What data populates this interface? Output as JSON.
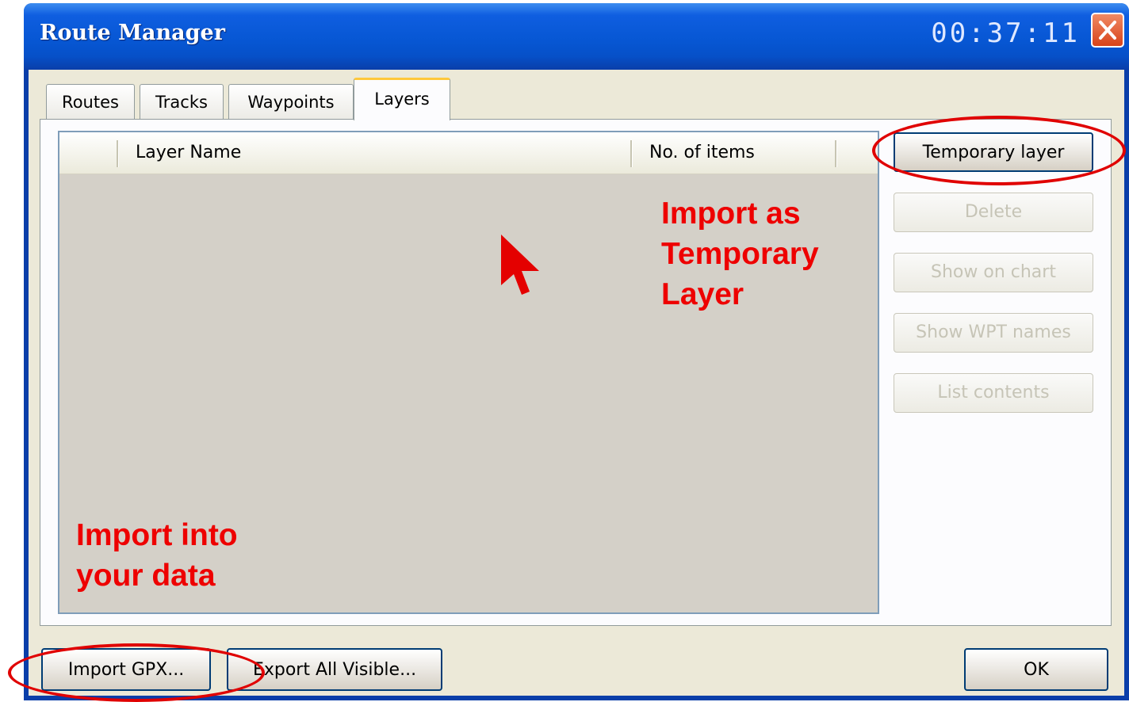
{
  "window": {
    "title": "Route Manager",
    "clock": "00:37:11"
  },
  "tabs": [
    {
      "label": "Routes"
    },
    {
      "label": "Tracks"
    },
    {
      "label": "Waypoints"
    },
    {
      "label": "Layers"
    }
  ],
  "list": {
    "columns": [
      "Layer Name",
      "No. of items"
    ]
  },
  "side_buttons": {
    "temporary_layer": "Temporary layer",
    "delete": "Delete",
    "show_on_chart": "Show on chart",
    "show_wpt_names": "Show WPT names",
    "list_contents": "List contents"
  },
  "bottom_buttons": {
    "import_gpx": "Import GPX...",
    "export_all_visible": "Export All Visible...",
    "ok": "OK"
  },
  "annotations": {
    "temporary": [
      "Import as",
      "Temporary",
      "Layer"
    ],
    "import": [
      "Import into",
      "your data"
    ]
  },
  "colors": {
    "annotation": "#ee0000",
    "titlebar": "#0757d4",
    "active_tab_accent": "#ffc83c"
  },
  "icons": {
    "close": "close-icon",
    "cursor": "arrow-cursor-icon"
  }
}
